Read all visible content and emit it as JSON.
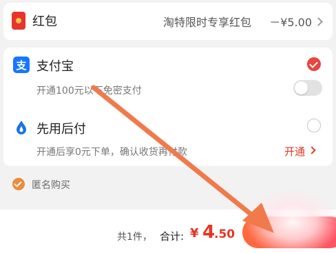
{
  "red_packet": {
    "label": "红包",
    "detail": "淘特限时专享红包",
    "amount": "－¥5.00",
    "icon": "red-packet-icon",
    "icon_color": "#e8342b"
  },
  "payment": {
    "alipay": {
      "label": "支付宝",
      "icon_glyph": "支",
      "icon": "alipay-icon",
      "selected": true,
      "brand_color": "#1677ff",
      "sub": "开通100元以下免密支付",
      "toggle_on": false
    },
    "pay_later": {
      "label": "先用后付",
      "icon": "drop-icon",
      "selected": false,
      "sub": "开通后享0元下单，确认收货再付款",
      "action": "开通",
      "action_color": "#e03a28"
    }
  },
  "anonymous": {
    "label": "匿名购买",
    "checked": true,
    "check_color": "#f08a3c"
  },
  "footer": {
    "count_text": "共1件，",
    "total_label": "合计:",
    "currency": "¥",
    "amount_int": "4",
    "amount_dec": ".50",
    "price_color": "#e93323"
  },
  "annotation": {
    "arrow_color": "#f07a4a"
  }
}
